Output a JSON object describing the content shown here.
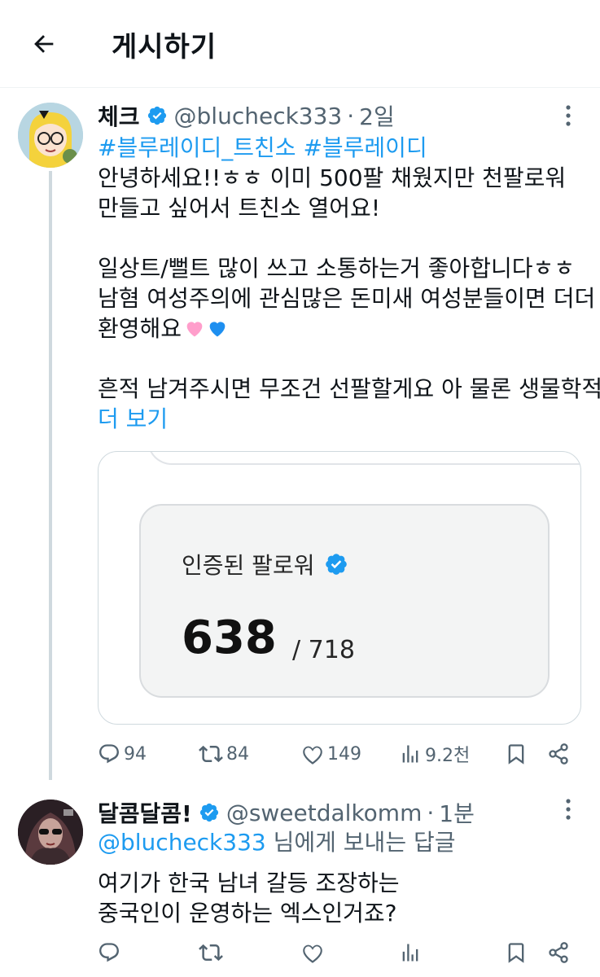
{
  "header": {
    "title": "게시하기"
  },
  "post": {
    "name": "체크",
    "handle": "@blucheck333",
    "separator": "·",
    "time": "2일",
    "hashtags": "#블루레이디_트친소 #블루레이디",
    "lines": [
      "안녕하세요!!ㅎㅎ 이미 500팔 채웠지만 천팔로워",
      "만들고 싶어서 트친소 열어요!",
      "",
      "일상트/뻘트 많이 쓰고 소통하는거 좋아합니다ㅎㅎ",
      "남혐 여성주의에 관심많은 돈미새 여성분들이면 더더",
      "환영해요",
      "",
      "흔적 남겨주시면 무조건 선팔할게요 아 물론 생물학적"
    ],
    "show_more": "더 보기",
    "media": {
      "label": "인증된 팔로워",
      "value": "638",
      "total": "/ 718"
    },
    "stats": {
      "replies": "94",
      "reposts": "84",
      "likes": "149",
      "views": "9.2천"
    }
  },
  "reply": {
    "name": "달콤달콤!",
    "handle": "@sweetdalkomm",
    "separator": "·",
    "time": "1분",
    "reply_to_handle": "@blucheck333",
    "reply_to_suffix": " 님에게 보내는 답글",
    "lines": [
      "여기가 한국 남녀 갈등 조장하는",
      "중국인이 운영하는 엑스인거죠?"
    ]
  },
  "colors": {
    "accent": "#1d9bf0",
    "secondary_text": "#536471",
    "thread_line": "#cfd9de"
  },
  "icons": [
    "back-arrow-icon",
    "verified-badge-icon",
    "more-dots-icon",
    "reply-icon",
    "repost-icon",
    "like-icon",
    "views-icon",
    "bookmark-icon",
    "share-icon",
    "pink-heart-emoji",
    "blue-heart-emoji"
  ]
}
